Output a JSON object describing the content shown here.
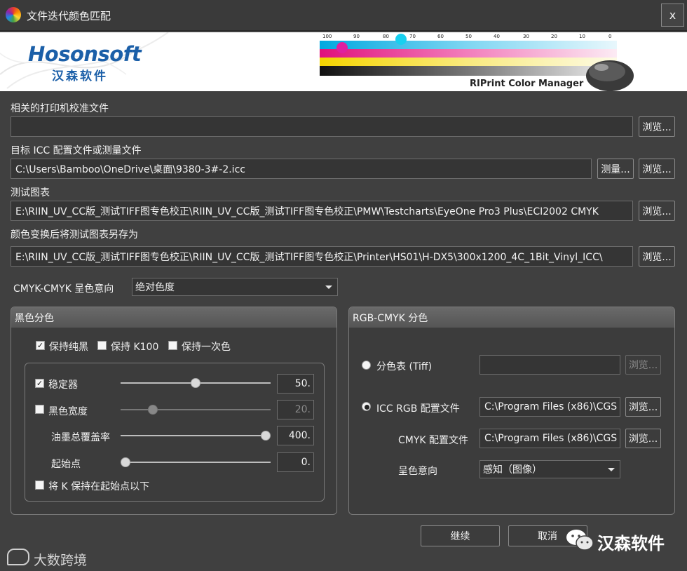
{
  "window": {
    "title": "文件迭代颜色匹配",
    "close_label": "x"
  },
  "banner": {
    "logo_text": "Hosonsoft",
    "logo_cn": "汉森软件",
    "caption": "RIPrint Color Manager",
    "scale_labels": [
      "100",
      "90",
      "80",
      "70",
      "60",
      "50",
      "40",
      "30",
      "20",
      "10",
      "0"
    ]
  },
  "printer_calibration": {
    "label": "相关的打印机校准文件",
    "value": "",
    "browse_label": "浏览..."
  },
  "target_icc": {
    "label": "目标 ICC 配置文件或测量文件",
    "value": "C:\\Users\\Bamboo\\OneDrive\\桌面\\9380-3#-2.icc",
    "measure_label": "测量...",
    "browse_label": "浏览..."
  },
  "test_chart": {
    "label": "测试图表",
    "value": "E:\\RIIN_UV_CC版_测试TIFF图专色校正\\RIIN_UV_CC版_测试TIFF图专色校正\\PMW\\Testcharts\\EyeOne Pro3 Plus\\ECI2002 CMYK",
    "browse_label": "浏览..."
  },
  "save_as": {
    "label": "颜色变换后将测试图表另存为",
    "value": "E:\\RIIN_UV_CC版_测试TIFF图专色校正\\RIIN_UV_CC版_测试TIFF图专色校正\\Printer\\HS01\\H-DX5\\300x1200_4C_1Bit_Vinyl_ICC\\",
    "browse_label": "浏览..."
  },
  "cmyk_intent": {
    "label": "CMYK-CMYK 呈色意向",
    "value": "绝对色度"
  },
  "black_group": {
    "title": "黑色分色",
    "keep_pure_black": {
      "label": "保持纯黑",
      "checked": true
    },
    "keep_k100": {
      "label": "保持 K100",
      "checked": false
    },
    "keep_once": {
      "label": "保持一次色",
      "checked": false
    },
    "stabilizer": {
      "label": "稳定器",
      "checked": true,
      "value": "50.",
      "level": 0.5
    },
    "black_width": {
      "label": "黑色宽度",
      "checked": false,
      "value": "20.",
      "level": 0.2
    },
    "ink_coverage": {
      "label": "油墨总覆盖率",
      "value": "400.",
      "level": 1.0
    },
    "start_point": {
      "label": "起始点",
      "value": "0.",
      "level": 0.0
    },
    "keep_k_below": {
      "label": "将 K 保持在起始点以下",
      "checked": false
    }
  },
  "rgb_group": {
    "title": "RGB-CMYK 分色",
    "separation_table": {
      "label": "分色表 (Tiff)",
      "value": "",
      "browse_label": "浏览..."
    },
    "icc_rgb": {
      "label": "ICC  RGB 配置文件",
      "value": "C:\\Program Files (x86)\\CGS",
      "browse_label": "浏览..."
    },
    "cmyk_profile": {
      "label": "CMYK 配置文件",
      "value": "C:\\Program Files (x86)\\CGS",
      "browse_label": "浏览..."
    },
    "intent": {
      "label": "呈色意向",
      "value": "感知（图像）"
    }
  },
  "footer": {
    "continue_label": "继续",
    "cancel_label": "取消"
  },
  "watermarks": {
    "left": "大数跨境",
    "right": "汉森软件"
  }
}
